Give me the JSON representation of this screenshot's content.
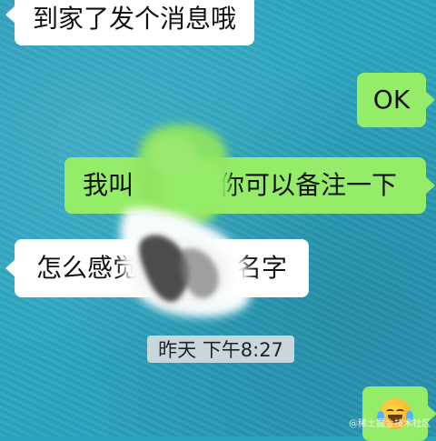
{
  "chat": {
    "messages": [
      {
        "side": "incoming",
        "text": "到家了发个消息哦"
      },
      {
        "side": "outgoing",
        "text": "OK"
      },
      {
        "side": "outgoing",
        "text_before": "我叫",
        "text_after": "你可以备注一下"
      },
      {
        "side": "incoming",
        "text_before": "怎么感觉",
        "text_after": "名字"
      },
      {
        "side": "outgoing",
        "emoji": "tears-of-joy-emoji-icon"
      }
    ],
    "timestamp": "昨天 下午8:27"
  },
  "watermark": "@稀土掘金技术社区",
  "colors": {
    "background": "#2aa3bf",
    "incoming_bubble": "#ffffff",
    "outgoing_bubble": "#95ec69",
    "timestamp_bg": "#c9d7db"
  }
}
